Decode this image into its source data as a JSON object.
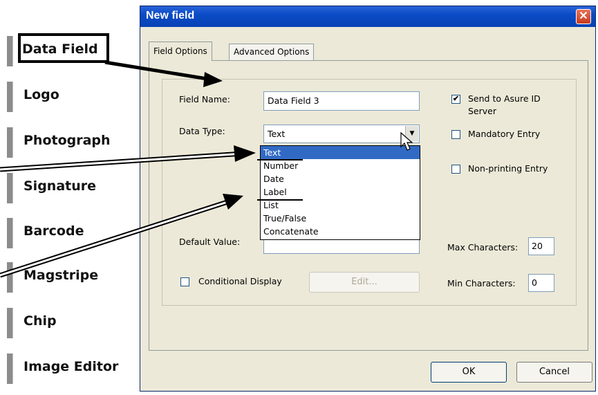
{
  "palette": {
    "items": [
      {
        "label": "Data Field"
      },
      {
        "label": "Logo"
      },
      {
        "label": "Photograph"
      },
      {
        "label": "Signature"
      },
      {
        "label": "Barcode"
      },
      {
        "label": "Magstripe"
      },
      {
        "label": "Chip"
      },
      {
        "label": "Image Editor"
      }
    ],
    "highlighted": "Data Field"
  },
  "dialog": {
    "title": "New field",
    "close_glyph": "✕",
    "tabs": [
      {
        "label": "Field Options",
        "active": true
      },
      {
        "label": "Advanced Options",
        "active": false
      }
    ],
    "field_name": {
      "label": "Field Name:",
      "value": "Data Field 3"
    },
    "data_type": {
      "label": "Data Type:",
      "value": "Text",
      "options": [
        "Text",
        "Number",
        "Date",
        "Label",
        "List",
        "True/False",
        "Concatenate"
      ]
    },
    "default_value": {
      "label": "Default Value:",
      "value": ""
    },
    "send_to_server": {
      "label_line1": "Send to Asure ID",
      "label_line2": "Server",
      "checked": true,
      "check_glyph": "✔"
    },
    "mandatory_entry": {
      "label": "Mandatory Entry",
      "checked": false
    },
    "non_printing_entry": {
      "label": "Non-printing Entry",
      "checked": false
    },
    "max_characters": {
      "label": "Max Characters:",
      "value": "20"
    },
    "min_characters": {
      "label": "Min Characters:",
      "value": "0"
    },
    "conditional_display": {
      "label": "Conditional Display",
      "checked": false
    },
    "edit_button": "Edit...",
    "ok_button": "OK",
    "cancel_button": "Cancel",
    "dropdown_glyph": "▼"
  },
  "colors": {
    "titlebar": "#0a4bc6",
    "dialog_bg": "#ece9d8",
    "selection": "#316ac5"
  }
}
